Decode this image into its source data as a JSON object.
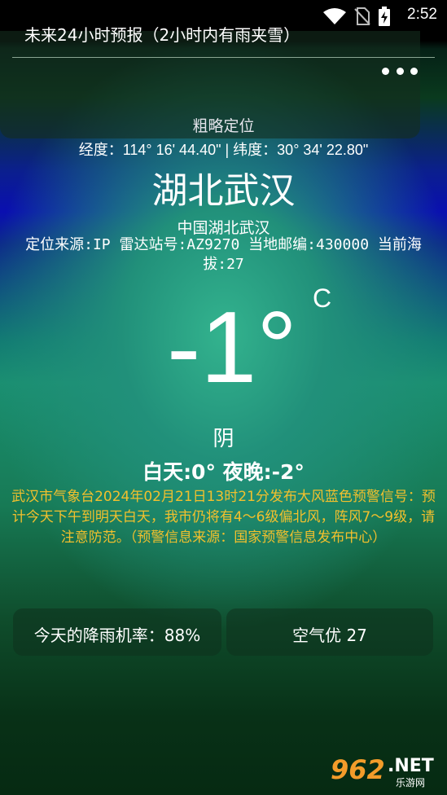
{
  "status": {
    "time": "2:52"
  },
  "location": {
    "mode": "粗略定位",
    "coords": "经度：114° 16' 44.40\" | 纬度：30° 34' 22.80\"",
    "city": "湖北武汉",
    "region": "中国湖北武汉",
    "details": "定位来源:IP 雷达站号:AZ9270 当地邮编:430000 当前海拔:27"
  },
  "weather": {
    "temperature": "-1°",
    "unit": "C",
    "condition": "阴",
    "range": "白天:0° 夜晚:-2°",
    "warning": "武汉市气象台2024年02月21日13时21分发布大风蓝色预警信号：预计今天下午到明天白天，我市仍将有4～6级偏北风，阵风7～9级，请注意防范。（预警信息来源：国家预警信息发布中心）"
  },
  "cards": {
    "rain": "今天的降雨机率：88%",
    "air": "空气优 27"
  },
  "forecast": {
    "title": "未来24小时预报（2小时内有雨夹雪）"
  },
  "watermark": {
    "num": "962",
    "net": ".NET",
    "cn": "乐游网"
  }
}
